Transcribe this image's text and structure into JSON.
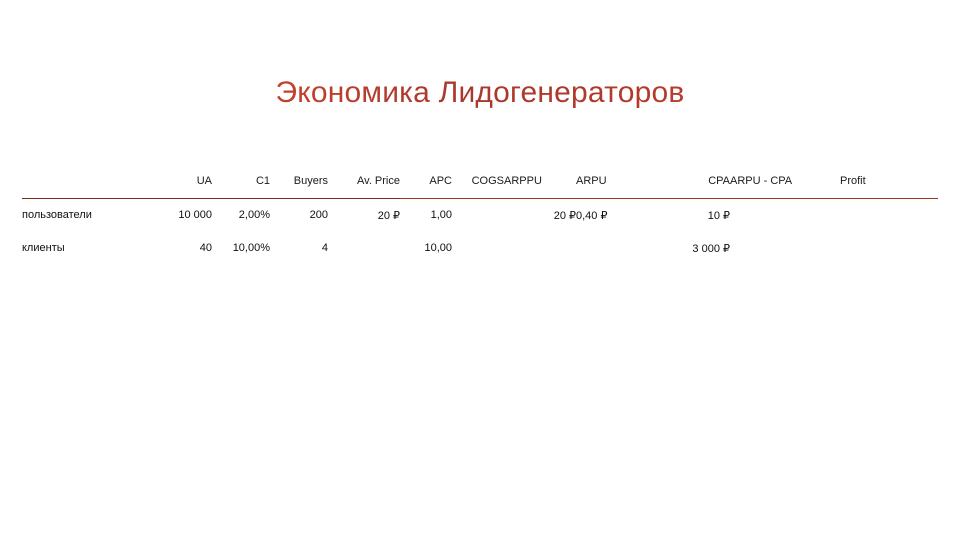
{
  "slide": {
    "title": "Экономика Лидогенераторов",
    "title_color_start": "#ec3b26",
    "title_color_mid": "#a8392c",
    "title_color_end": "#b23a28",
    "rule_color": "#7d2b18"
  },
  "table": {
    "columns": [
      {
        "key": "label",
        "label": ""
      },
      {
        "key": "ua",
        "label": "UA"
      },
      {
        "key": "c1",
        "label": "C1"
      },
      {
        "key": "buyers",
        "label": "Buyers"
      },
      {
        "key": "price",
        "label": "Av. Price"
      },
      {
        "key": "apc",
        "label": "APC"
      },
      {
        "key": "cogs",
        "label": "COGS"
      },
      {
        "key": "arppu",
        "label": "ARPPU"
      },
      {
        "key": "arpu",
        "label": "ARPU"
      },
      {
        "key": "cpa",
        "label": "CPA"
      },
      {
        "key": "arpucpa",
        "label": "ARPU - CPA"
      },
      {
        "key": "profit",
        "label": "Profit"
      }
    ],
    "rows": [
      {
        "label": "пользователи",
        "ua": "10 000",
        "c1": "2,00%",
        "buyers": "200",
        "price": "20 ₽",
        "apc": "1,00",
        "cogs": "",
        "arppu": "20 ₽",
        "arpu": "0,40 ₽",
        "cpa": "10 ₽",
        "arpucpa": "",
        "profit": ""
      },
      {
        "label": "клиенты",
        "ua": "40",
        "c1": "10,00%",
        "buyers": "4",
        "price": "",
        "apc": "10,00",
        "cogs": "",
        "arppu": "",
        "arpu": "",
        "cpa": "3 000 ₽",
        "arpucpa": "",
        "profit": ""
      }
    ]
  }
}
